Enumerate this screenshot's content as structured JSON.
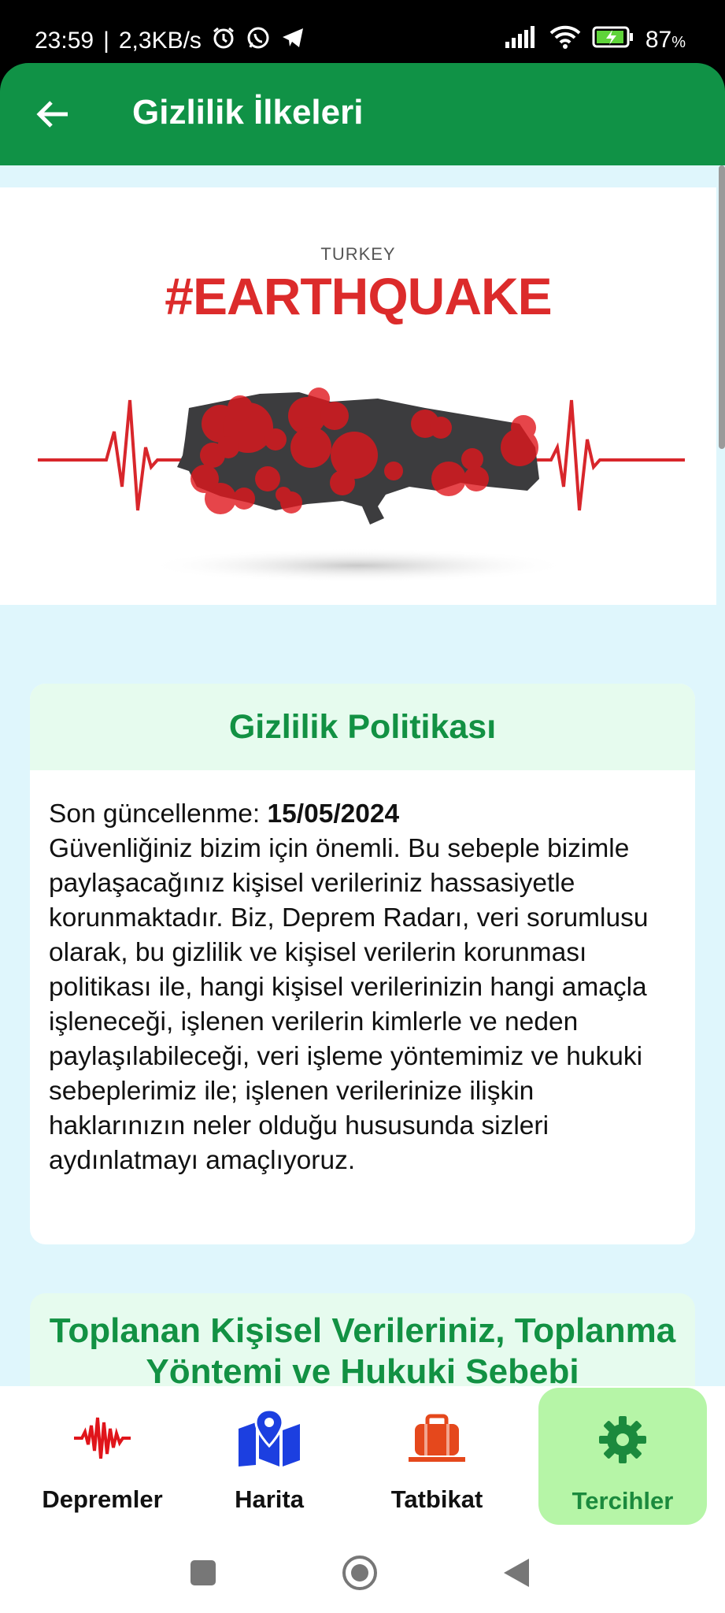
{
  "status_bar": {
    "time": "23:59",
    "separator": "|",
    "speed": "2,3KB/s",
    "battery_percent": "87",
    "battery_suffix": "%",
    "icons": [
      "alarm-icon",
      "whatsapp-icon",
      "telegram-icon",
      "signal-icon",
      "wifi-icon",
      "battery-icon"
    ]
  },
  "app_bar": {
    "title": "Gizlilik İlkeleri",
    "back_icon": "arrow-left-icon",
    "color": "#109246"
  },
  "banner": {
    "small_text": "TURKEY",
    "big_text": "#EARTHQUAKE"
  },
  "policy_card": {
    "title": "Gizlilik Politikası",
    "updated_label": "Son güncellenme:",
    "updated_date": "15/05/2024",
    "paragraph": "Güvenliğiniz bizim için önemli. Bu sebeple bizimle paylaşacağınız kişisel verileriniz hassasiyetle korunmaktadır. Biz, Deprem Radarı, veri sorumlusu olarak, bu gizlilik ve kişisel verilerin korunması politikası ile, hangi kişisel verilerinizin hangi amaçla işleneceği, işlenen verilerin kimlerle ve neden paylaşılabileceği, veri işleme yöntemimiz ve hukuki sebeplerimiz ile; işlenen verilerinize ilişkin haklarınızın neler olduğu hususunda sizleri aydınlatmayı amaçlıyoruz."
  },
  "section_card": {
    "title": "Toplanan Kişisel Verileriniz, Toplanma Yöntemi ve Hukuki Sebebi"
  },
  "bottom_nav": {
    "items": [
      {
        "label": "Depremler",
        "icon": "seismograph-icon",
        "color": "#e0151b"
      },
      {
        "label": "Harita",
        "icon": "map-pin-icon",
        "color": "#1c3fe0"
      },
      {
        "label": "Tatbikat",
        "icon": "briefcase-icon",
        "color": "#e5481c"
      },
      {
        "label": "Tercihler",
        "icon": "gear-icon",
        "color": "#1b8a3d",
        "selected": true
      }
    ]
  },
  "system_nav": {
    "buttons": [
      "recent-apps-icon",
      "home-icon",
      "back-icon"
    ]
  }
}
